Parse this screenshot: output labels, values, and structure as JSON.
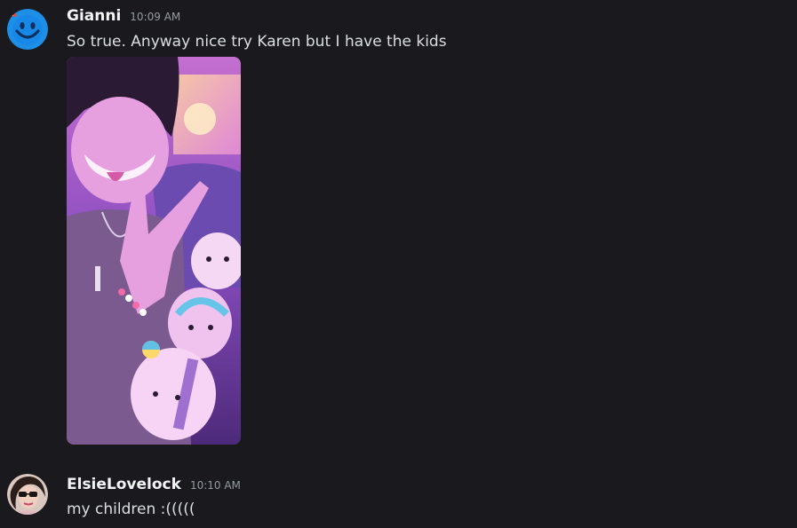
{
  "messages": [
    {
      "username": "Gianni",
      "timestamp": "10:09 AM",
      "text": "So true. Anyway nice try Karen but I have the kids",
      "avatar_icon": "smiley-face-avatar",
      "avatar_color": "#1e8fe6",
      "attachment": "photo"
    },
    {
      "username": "ElsieLovelock",
      "timestamp": "10:10 AM",
      "text": "my children :(((((",
      "avatar_icon": "profile-photo-avatar"
    }
  ],
  "colors": {
    "background": "#1a1a1e",
    "username": "#f2f3f5",
    "timestamp": "#949ba4",
    "message_text": "#dbdee1"
  }
}
